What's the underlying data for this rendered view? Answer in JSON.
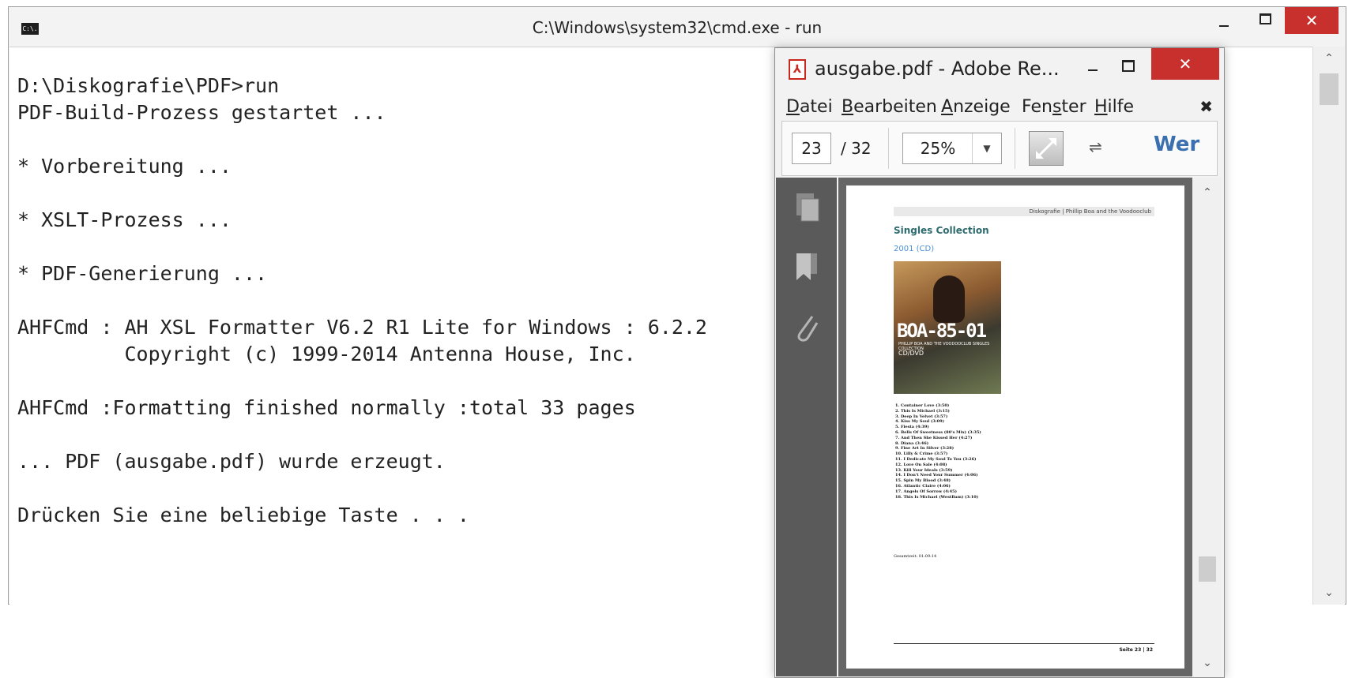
{
  "cmd": {
    "title": "C:\\Windows\\system32\\cmd.exe - run",
    "icon_label": "C:\\.",
    "close_glyph": "✕",
    "scroll_up": "⌃",
    "scroll_down": "⌄",
    "lines": [
      "D:\\Diskografie\\PDF>run",
      "PDF-Build-Prozess gestartet ...",
      "",
      "* Vorbereitung ...",
      "",
      "* XSLT-Prozess ...",
      "",
      "* PDF-Generierung ...",
      "",
      "AHFCmd : AH XSL Formatter V6.2 R1 Lite for Windows : 6.2.2",
      "         Copyright (c) 1999-2014 Antenna House, Inc.",
      "",
      "AHFCmd :Formatting finished normally :total 33 pages",
      "",
      "... PDF (ausgabe.pdf) wurde erzeugt.",
      "",
      "Drücken Sie eine beliebige Taste . . ."
    ]
  },
  "pdf": {
    "title": "ausgabe.pdf - Adobe Re...",
    "close_glyph": "✕",
    "menu": [
      {
        "pre": "",
        "key": "D",
        "post": "atei"
      },
      {
        "pre": "",
        "key": "B",
        "post": "earbeiten"
      },
      {
        "pre": "",
        "key": "A",
        "post": "nzeige"
      },
      {
        "pre": "Fen",
        "key": "s",
        "post": "ter"
      },
      {
        "pre": "",
        "key": "H",
        "post": "ilfe"
      }
    ],
    "menu_close": "✖",
    "current_page": "23",
    "total_pages": "/ 32",
    "zoom": "25%",
    "zoom_dropdown": "▼",
    "more_glyph": "⇌",
    "toolbar_text": "Wer",
    "scroll_up": "⌃",
    "scroll_down": "⌄",
    "document": {
      "header": "Diskografie | Phillip Boa and the Voodooclub",
      "title": "Singles Collection",
      "subtitle": "2001 (CD)",
      "cover_text": "BOA-85-01",
      "cover_small": "PHILLIP BOA AND THE VOODOOCLUB SINGLES COLLECTION",
      "cover_code": "CD/DVD",
      "tracks": [
        "1.  Container Love (3:50)",
        "2.  This Is Michael (3:15)",
        "3.  Deep In Velvet (3:57)",
        "4.  Kiss My Soul (3:09)",
        "5.  Fiesta (4:39)",
        "6.  Bells Of Sweetness (80's Mix) (3:35)",
        "7.  And Then She Kissed Her (4:27)",
        "8.  Diana (3:46)",
        "9.  Fine Art In Silver (3:28)",
        "10. Lilly & Crime (3:57)",
        "11. I Dedicate My Soul To You (3:26)",
        "12. Love On Sale (4:08)",
        "13. Kill Your Ideals (3:59)",
        "14. I Don't Need Your Summer (4:06)",
        "15. Spin My Blood (3:48)",
        "16. Atlantic Claire (4:06)",
        "17. Angels Of Sorrow (4:45)",
        "18. This Is Michael (WestBam) (3:10)"
      ],
      "total": "Gesamtzeit: 01:09:14",
      "footer": "Seite 23 | 32"
    }
  }
}
